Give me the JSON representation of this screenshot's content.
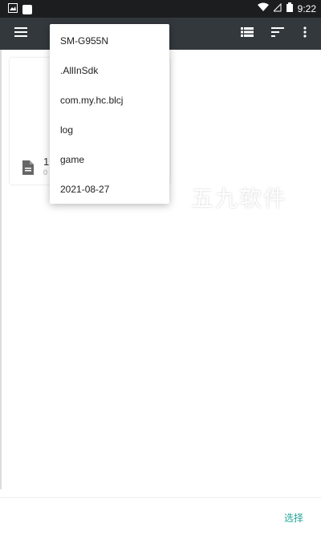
{
  "status_bar": {
    "time": "9:22",
    "left_icons": [
      "gallery-icon",
      "notification-square-icon"
    ],
    "right_icons": [
      "wifi-icon",
      "signal-icon",
      "battery-icon"
    ]
  },
  "toolbar": {
    "menu_icon": "menu-icon",
    "right_icons": [
      "list-view-icon",
      "sort-icon",
      "more-vert-icon"
    ]
  },
  "card": {
    "name": "1",
    "sub": "0"
  },
  "dropdown": {
    "items": [
      "SM-G955N",
      ".AllInSdk",
      "com.my.hc.blcj",
      "log",
      "game",
      "2021-08-27"
    ]
  },
  "watermark": {
    "text": "五九软件"
  },
  "bottom_bar": {
    "select_label": "选择"
  },
  "colors": {
    "status_bar": "#1b1d1f",
    "app_bar": "#33383d",
    "accent": "#26a69a"
  }
}
